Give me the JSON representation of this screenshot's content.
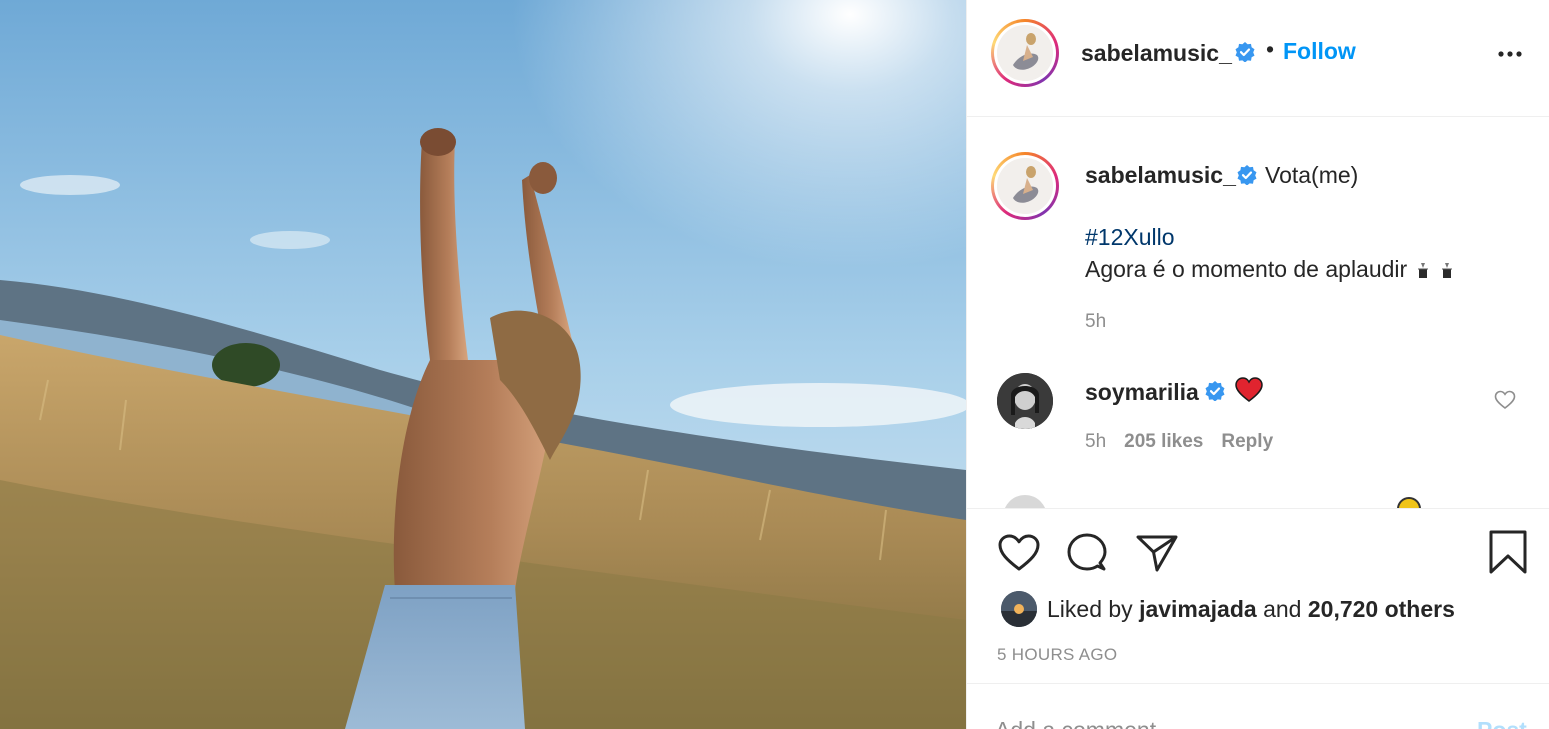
{
  "post": {
    "username": "sabelamusic_",
    "follow_label": "Follow",
    "separator": "•"
  },
  "caption": {
    "username": "sabelamusic_",
    "text": "Vota(me)",
    "hashtag": "#12Xullo",
    "line2": "Agora é o momento de aplaudir",
    "time": "5h"
  },
  "comment": {
    "username": "soymarilia",
    "emoji": "heart-emoji",
    "time": "5h",
    "likes": "205 likes",
    "reply": "Reply"
  },
  "likes": {
    "prefix": "Liked by",
    "user": "javimajada",
    "conjunction": "and",
    "others": "20,720 others"
  },
  "timestamp": "5 HOURS AGO",
  "add_comment": {
    "placeholder": "Add a comment...",
    "post_label": "Post"
  },
  "colors": {
    "accent": "#0095f6",
    "verified": "#3897f0",
    "muted_text": "#8e8e8e",
    "hashtag": "#00376b"
  },
  "icons": [
    "verified-badge-icon",
    "more-options-icon",
    "heart-icon",
    "comment-icon",
    "share-icon",
    "bookmark-icon",
    "clap-emoji-icon"
  ]
}
